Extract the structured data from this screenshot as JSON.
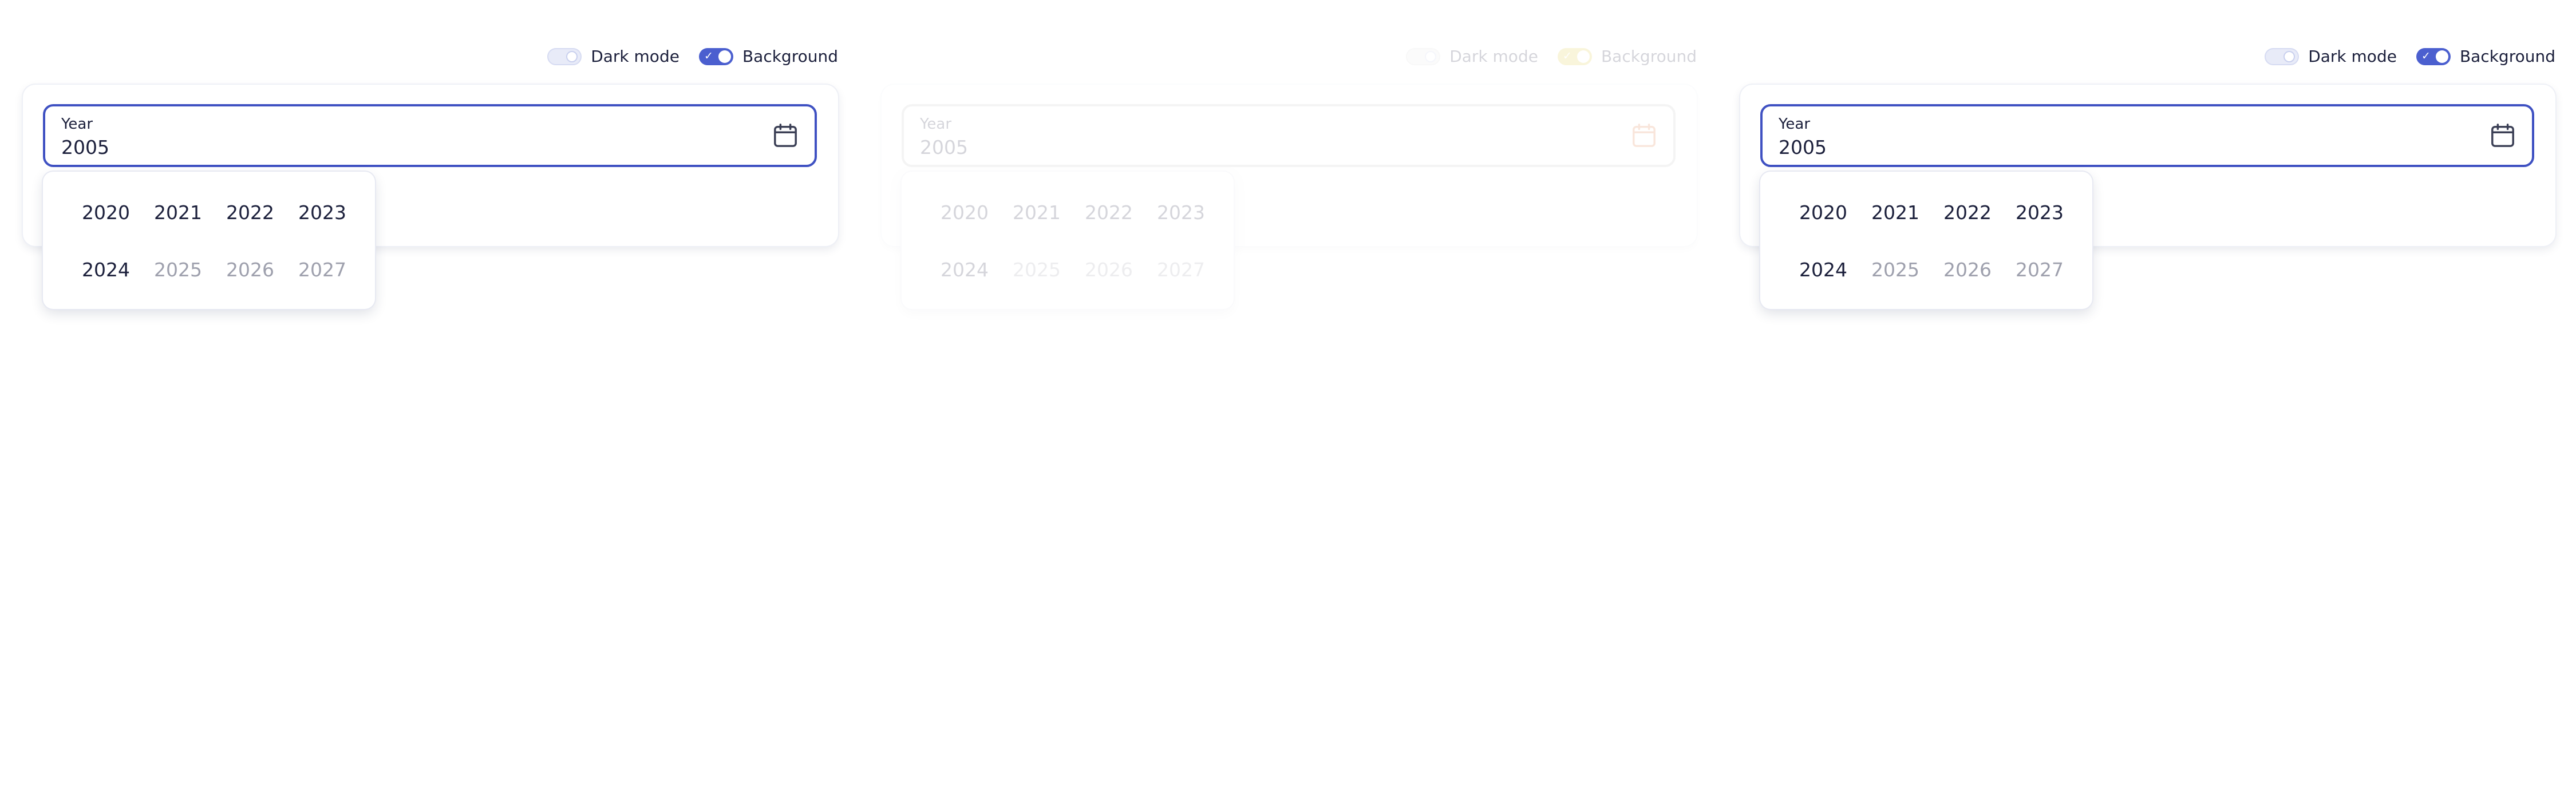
{
  "toggles": {
    "dark_mode_label": "Dark mode",
    "background_label": "Background",
    "check_glyph": "✓"
  },
  "field": {
    "label": "Year",
    "value": "2005",
    "icon": "calendar-icon"
  },
  "years": [
    {
      "label": "2020",
      "state": "current"
    },
    {
      "label": "2021",
      "state": "normal"
    },
    {
      "label": "2022",
      "state": "normal"
    },
    {
      "label": "2023",
      "state": "normal"
    },
    {
      "label": "2024",
      "state": "normal"
    },
    {
      "label": "2025",
      "state": "disabled"
    },
    {
      "label": "2026",
      "state": "disabled"
    },
    {
      "label": "2027",
      "state": "disabled"
    }
  ],
  "colors": {
    "accent": "#3f51c2",
    "text": "#1b1f3b",
    "muted": "#9ea0ad",
    "switch_on": "#4b5fcf",
    "faded_icon": "#e07a45",
    "faded_switch": "#e3c93b"
  }
}
